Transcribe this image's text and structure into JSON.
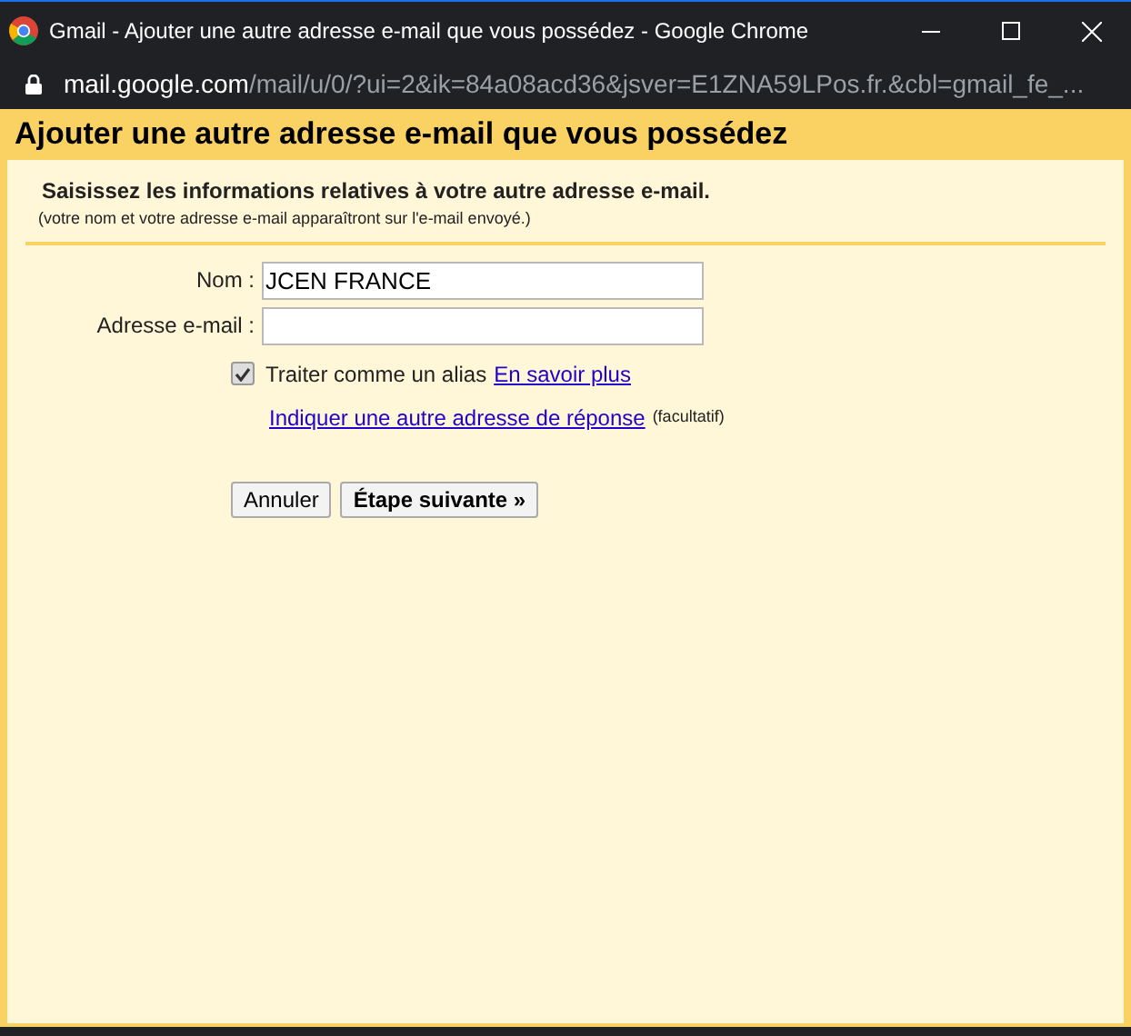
{
  "window": {
    "title": "Gmail - Ajouter une autre adresse e-mail que vous possédez - Google Chrome"
  },
  "address_bar": {
    "domain": "mail.google.com",
    "path": "/mail/u/0/?ui=2&ik=84a08acd36&jsver=E1ZNA59LPos.fr.&cbl=gmail_fe_..."
  },
  "dialog": {
    "title": "Ajouter une autre adresse e-mail que vous possédez",
    "heading": "Saisissez les informations relatives à votre autre adresse e-mail.",
    "note": "(votre nom et votre adresse e-mail apparaîtront sur l'e-mail envoyé.)",
    "fields": [
      {
        "label": "Nom :",
        "value": "JCEN FRANCE"
      },
      {
        "label": "Adresse e-mail :"
      }
    ],
    "alias": {
      "label": "Traiter comme un alias",
      "checked": true,
      "link": "En savoir plus"
    },
    "reply_to": {
      "link": "Indiquer une autre adresse de réponse",
      "hint": "(facultatif)"
    },
    "buttons": [
      {
        "label": "Annuler",
        "kind": "secondary"
      },
      {
        "label": "Étape suivante »",
        "kind": "primary"
      }
    ]
  }
}
